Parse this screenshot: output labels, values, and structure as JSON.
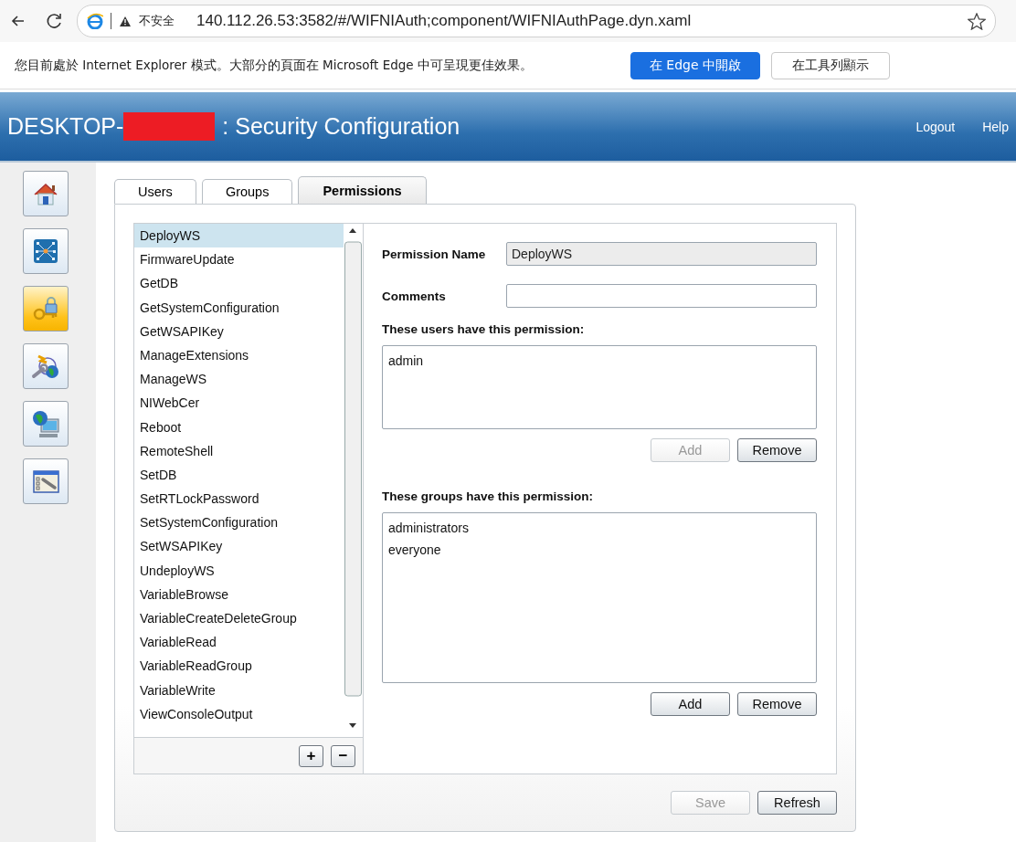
{
  "browser": {
    "security_label": "不安全",
    "url": "140.112.26.53:3582/#/WIFNIAuth;component/WIFNIAuthPage.dyn.xaml"
  },
  "ie_mode_bar": {
    "message": "您目前處於 Internet Explorer 模式。大部分的頁面在 Microsoft Edge 中可呈現更佳效果。",
    "buttons": [
      {
        "label": "在 Edge 中開啟",
        "kind": "primary"
      },
      {
        "label": "在工具列顯示",
        "kind": "secondary"
      }
    ]
  },
  "header": {
    "title_prefix": "DESKTOP-",
    "redacted": true,
    "title_suffix": ": Security Configuration",
    "links": [
      "Logout",
      "Help"
    ]
  },
  "sidebar": {
    "items": [
      {
        "kind": "home",
        "selected": false
      },
      {
        "kind": "network",
        "selected": false
      },
      {
        "kind": "security",
        "selected": true
      },
      {
        "kind": "remote",
        "selected": false
      },
      {
        "kind": "computer",
        "selected": false
      },
      {
        "kind": "tools",
        "selected": false
      }
    ]
  },
  "tabs": [
    {
      "label": "Users",
      "selected": false
    },
    {
      "label": "Groups",
      "selected": false
    },
    {
      "label": "Permissions",
      "selected": true
    }
  ],
  "permissions": [
    {
      "name": "DeployWS",
      "selected": true
    },
    {
      "name": "FirmwareUpdate",
      "selected": false
    },
    {
      "name": "GetDB",
      "selected": false
    },
    {
      "name": "GetSystemConfiguration",
      "selected": false
    },
    {
      "name": "GetWSAPIKey",
      "selected": false
    },
    {
      "name": "ManageExtensions",
      "selected": false
    },
    {
      "name": "ManageWS",
      "selected": false
    },
    {
      "name": "NIWebCer",
      "selected": false
    },
    {
      "name": "Reboot",
      "selected": false
    },
    {
      "name": "RemoteShell",
      "selected": false
    },
    {
      "name": "SetDB",
      "selected": false
    },
    {
      "name": "SetRTLockPassword",
      "selected": false
    },
    {
      "name": "SetSystemConfiguration",
      "selected": false
    },
    {
      "name": "SetWSAPIKey",
      "selected": false
    },
    {
      "name": "UndeployWS",
      "selected": false
    },
    {
      "name": "VariableBrowse",
      "selected": false
    },
    {
      "name": "VariableCreateDeleteGroup",
      "selected": false
    },
    {
      "name": "VariableRead",
      "selected": false
    },
    {
      "name": "VariableReadGroup",
      "selected": false
    },
    {
      "name": "VariableWrite",
      "selected": false
    },
    {
      "name": "ViewConsoleOutput",
      "selected": false
    }
  ],
  "list_buttons": [
    "+",
    "−"
  ],
  "details": {
    "fields": [
      {
        "label": "Permission Name",
        "value": "DeployWS",
        "disabled": true
      },
      {
        "label": "Comments",
        "disabled": false
      }
    ],
    "users": {
      "heading": "These users have this permission:",
      "items": [
        "admin"
      ],
      "buttons": [
        {
          "label": "Add",
          "disabled": true
        },
        {
          "label": "Remove",
          "disabled": false
        }
      ]
    },
    "groups": {
      "heading": "These groups have this permission:",
      "items": [
        "administrators",
        "everyone"
      ],
      "buttons": [
        {
          "label": "Add",
          "disabled": false
        },
        {
          "label": "Remove",
          "disabled": false
        }
      ]
    }
  },
  "footer_buttons": [
    {
      "label": "Save",
      "disabled": true
    },
    {
      "label": "Refresh",
      "disabled": false
    }
  ]
}
